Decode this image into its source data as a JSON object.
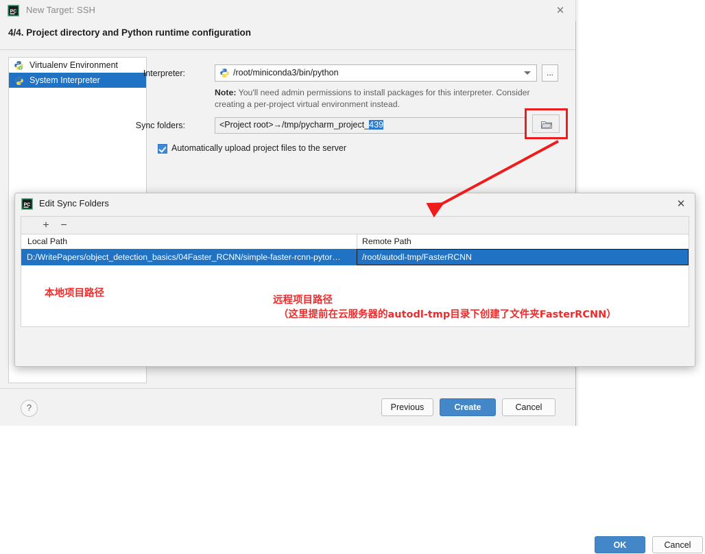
{
  "main_dialog": {
    "titlebar": {
      "icon": "pycharm-icon",
      "title": "New Target: SSH",
      "close_icon": "close-icon"
    },
    "step_heading": "4/4. Project directory and Python runtime configuration",
    "env_list": [
      {
        "label": "Virtualenv Environment",
        "icon": "virtualenv-icon",
        "selected": false
      },
      {
        "label": "System Interpreter",
        "icon": "python-icon",
        "selected": true
      }
    ],
    "interpreter": {
      "label": "Interpreter:",
      "value": "/root/miniconda3/bin/python",
      "icon": "python-icon",
      "browse_label": "...",
      "caret_icon": "chevron-down-icon",
      "note_bold": "Note:",
      "note_text": " You'll need admin permissions to install packages for this interpreter. Consider creating a per-project virtual environment instead."
    },
    "sync_folders": {
      "label": "Sync folders:",
      "value_prefix": "<Project root>→/tmp/pycharm_project_",
      "value_selected": "439",
      "browse_icon": "folder-icon"
    },
    "auto_upload": {
      "label": "Automatically upload project files to the server",
      "checked": true
    },
    "footer": {
      "help_label": "?",
      "previous_label": "Previous",
      "create_label": "Create",
      "cancel_label": "Cancel"
    }
  },
  "sync_dialog": {
    "titlebar": {
      "icon": "pycharm-icon",
      "title": "Edit Sync Folders",
      "close_icon": "close-icon"
    },
    "toolbar": {
      "add_label": "+",
      "remove_label": "−"
    },
    "table": {
      "columns": [
        "Local Path",
        "Remote Path"
      ],
      "rows": [
        {
          "local_path": "D:/WritePapers/object_detection_basics/04Faster_RCNN/simple-faster-rcnn-pytor…",
          "remote_path": "/root/autodl-tmp/FasterRCNN",
          "selected": true
        }
      ]
    },
    "footer": {
      "ok_label": "OK",
      "cancel_label": "Cancel"
    }
  },
  "annotations": {
    "local_note": "本地项目路径",
    "remote_note_line1": "远程项目路径",
    "remote_note_line2": "（这里提前在云服务器的autodl-tmp目录下创建了文件夹FasterRCNN）",
    "accent_color": "#ef2b2b",
    "highlight_box": "folder-browse-button",
    "arrow": "arrow-pointing-to-edit-sync-folders-dialog"
  }
}
